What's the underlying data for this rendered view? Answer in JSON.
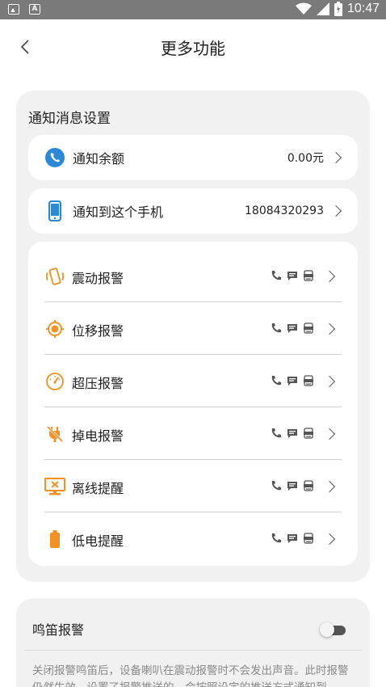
{
  "status_bar": {
    "time": "10:47",
    "left_icons": [
      "image-icon",
      "a-icon"
    ],
    "right_icons": [
      "wifi-icon",
      "signal-icon",
      "battery-icon"
    ]
  },
  "header": {
    "title": "更多功能",
    "back_icon": "chevron-left-icon"
  },
  "notification_settings": {
    "section_title": "通知消息设置",
    "balance": {
      "label": "通知余额",
      "value": "0.00元",
      "icon": "phone-circle-icon"
    },
    "phone": {
      "label": "通知到这个手机",
      "value": "18084320293",
      "icon": "mobile-phone-icon"
    },
    "alarms": [
      {
        "label": "震动报警",
        "icon": "vibration-icon"
      },
      {
        "label": "位移报警",
        "icon": "location-target-icon"
      },
      {
        "label": "超压报警",
        "icon": "gauge-icon"
      },
      {
        "label": "掉电报警",
        "icon": "power-off-icon"
      },
      {
        "label": "离线提醒",
        "icon": "offline-monitor-icon"
      },
      {
        "label": "低电提醒",
        "icon": "low-battery-icon"
      }
    ],
    "notify_type_icons": [
      "phone-call-icon",
      "sms-icon",
      "wechat-icon"
    ]
  },
  "whistle": {
    "label": "鸣笛报警",
    "enabled": false,
    "description": "关闭报警鸣笛后，设备喇叭在震动报警时不会发出声音。此时报警仍然生效，设置了报警推送的，会按照设定的推送方式通知到"
  },
  "colors": {
    "accent_blue": "#2b8ad8",
    "accent_orange": "#f39222",
    "panel_bg": "#f1f1f1"
  }
}
